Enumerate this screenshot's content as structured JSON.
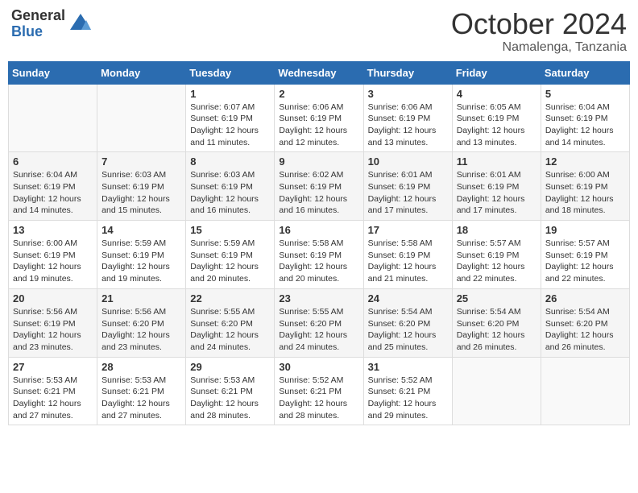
{
  "header": {
    "logo_general": "General",
    "logo_blue": "Blue",
    "month_year": "October 2024",
    "location": "Namalenga, Tanzania"
  },
  "weekdays": [
    "Sunday",
    "Monday",
    "Tuesday",
    "Wednesday",
    "Thursday",
    "Friday",
    "Saturday"
  ],
  "weeks": [
    [
      {
        "day": "",
        "sunrise": "",
        "sunset": "",
        "daylight": ""
      },
      {
        "day": "",
        "sunrise": "",
        "sunset": "",
        "daylight": ""
      },
      {
        "day": "1",
        "sunrise": "Sunrise: 6:07 AM",
        "sunset": "Sunset: 6:19 PM",
        "daylight": "Daylight: 12 hours and 11 minutes."
      },
      {
        "day": "2",
        "sunrise": "Sunrise: 6:06 AM",
        "sunset": "Sunset: 6:19 PM",
        "daylight": "Daylight: 12 hours and 12 minutes."
      },
      {
        "day": "3",
        "sunrise": "Sunrise: 6:06 AM",
        "sunset": "Sunset: 6:19 PM",
        "daylight": "Daylight: 12 hours and 13 minutes."
      },
      {
        "day": "4",
        "sunrise": "Sunrise: 6:05 AM",
        "sunset": "Sunset: 6:19 PM",
        "daylight": "Daylight: 12 hours and 13 minutes."
      },
      {
        "day": "5",
        "sunrise": "Sunrise: 6:04 AM",
        "sunset": "Sunset: 6:19 PM",
        "daylight": "Daylight: 12 hours and 14 minutes."
      }
    ],
    [
      {
        "day": "6",
        "sunrise": "Sunrise: 6:04 AM",
        "sunset": "Sunset: 6:19 PM",
        "daylight": "Daylight: 12 hours and 14 minutes."
      },
      {
        "day": "7",
        "sunrise": "Sunrise: 6:03 AM",
        "sunset": "Sunset: 6:19 PM",
        "daylight": "Daylight: 12 hours and 15 minutes."
      },
      {
        "day": "8",
        "sunrise": "Sunrise: 6:03 AM",
        "sunset": "Sunset: 6:19 PM",
        "daylight": "Daylight: 12 hours and 16 minutes."
      },
      {
        "day": "9",
        "sunrise": "Sunrise: 6:02 AM",
        "sunset": "Sunset: 6:19 PM",
        "daylight": "Daylight: 12 hours and 16 minutes."
      },
      {
        "day": "10",
        "sunrise": "Sunrise: 6:01 AM",
        "sunset": "Sunset: 6:19 PM",
        "daylight": "Daylight: 12 hours and 17 minutes."
      },
      {
        "day": "11",
        "sunrise": "Sunrise: 6:01 AM",
        "sunset": "Sunset: 6:19 PM",
        "daylight": "Daylight: 12 hours and 17 minutes."
      },
      {
        "day": "12",
        "sunrise": "Sunrise: 6:00 AM",
        "sunset": "Sunset: 6:19 PM",
        "daylight": "Daylight: 12 hours and 18 minutes."
      }
    ],
    [
      {
        "day": "13",
        "sunrise": "Sunrise: 6:00 AM",
        "sunset": "Sunset: 6:19 PM",
        "daylight": "Daylight: 12 hours and 19 minutes."
      },
      {
        "day": "14",
        "sunrise": "Sunrise: 5:59 AM",
        "sunset": "Sunset: 6:19 PM",
        "daylight": "Daylight: 12 hours and 19 minutes."
      },
      {
        "day": "15",
        "sunrise": "Sunrise: 5:59 AM",
        "sunset": "Sunset: 6:19 PM",
        "daylight": "Daylight: 12 hours and 20 minutes."
      },
      {
        "day": "16",
        "sunrise": "Sunrise: 5:58 AM",
        "sunset": "Sunset: 6:19 PM",
        "daylight": "Daylight: 12 hours and 20 minutes."
      },
      {
        "day": "17",
        "sunrise": "Sunrise: 5:58 AM",
        "sunset": "Sunset: 6:19 PM",
        "daylight": "Daylight: 12 hours and 21 minutes."
      },
      {
        "day": "18",
        "sunrise": "Sunrise: 5:57 AM",
        "sunset": "Sunset: 6:19 PM",
        "daylight": "Daylight: 12 hours and 22 minutes."
      },
      {
        "day": "19",
        "sunrise": "Sunrise: 5:57 AM",
        "sunset": "Sunset: 6:19 PM",
        "daylight": "Daylight: 12 hours and 22 minutes."
      }
    ],
    [
      {
        "day": "20",
        "sunrise": "Sunrise: 5:56 AM",
        "sunset": "Sunset: 6:19 PM",
        "daylight": "Daylight: 12 hours and 23 minutes."
      },
      {
        "day": "21",
        "sunrise": "Sunrise: 5:56 AM",
        "sunset": "Sunset: 6:20 PM",
        "daylight": "Daylight: 12 hours and 23 minutes."
      },
      {
        "day": "22",
        "sunrise": "Sunrise: 5:55 AM",
        "sunset": "Sunset: 6:20 PM",
        "daylight": "Daylight: 12 hours and 24 minutes."
      },
      {
        "day": "23",
        "sunrise": "Sunrise: 5:55 AM",
        "sunset": "Sunset: 6:20 PM",
        "daylight": "Daylight: 12 hours and 24 minutes."
      },
      {
        "day": "24",
        "sunrise": "Sunrise: 5:54 AM",
        "sunset": "Sunset: 6:20 PM",
        "daylight": "Daylight: 12 hours and 25 minutes."
      },
      {
        "day": "25",
        "sunrise": "Sunrise: 5:54 AM",
        "sunset": "Sunset: 6:20 PM",
        "daylight": "Daylight: 12 hours and 26 minutes."
      },
      {
        "day": "26",
        "sunrise": "Sunrise: 5:54 AM",
        "sunset": "Sunset: 6:20 PM",
        "daylight": "Daylight: 12 hours and 26 minutes."
      }
    ],
    [
      {
        "day": "27",
        "sunrise": "Sunrise: 5:53 AM",
        "sunset": "Sunset: 6:21 PM",
        "daylight": "Daylight: 12 hours and 27 minutes."
      },
      {
        "day": "28",
        "sunrise": "Sunrise: 5:53 AM",
        "sunset": "Sunset: 6:21 PM",
        "daylight": "Daylight: 12 hours and 27 minutes."
      },
      {
        "day": "29",
        "sunrise": "Sunrise: 5:53 AM",
        "sunset": "Sunset: 6:21 PM",
        "daylight": "Daylight: 12 hours and 28 minutes."
      },
      {
        "day": "30",
        "sunrise": "Sunrise: 5:52 AM",
        "sunset": "Sunset: 6:21 PM",
        "daylight": "Daylight: 12 hours and 28 minutes."
      },
      {
        "day": "31",
        "sunrise": "Sunrise: 5:52 AM",
        "sunset": "Sunset: 6:21 PM",
        "daylight": "Daylight: 12 hours and 29 minutes."
      },
      {
        "day": "",
        "sunrise": "",
        "sunset": "",
        "daylight": ""
      },
      {
        "day": "",
        "sunrise": "",
        "sunset": "",
        "daylight": ""
      }
    ]
  ]
}
